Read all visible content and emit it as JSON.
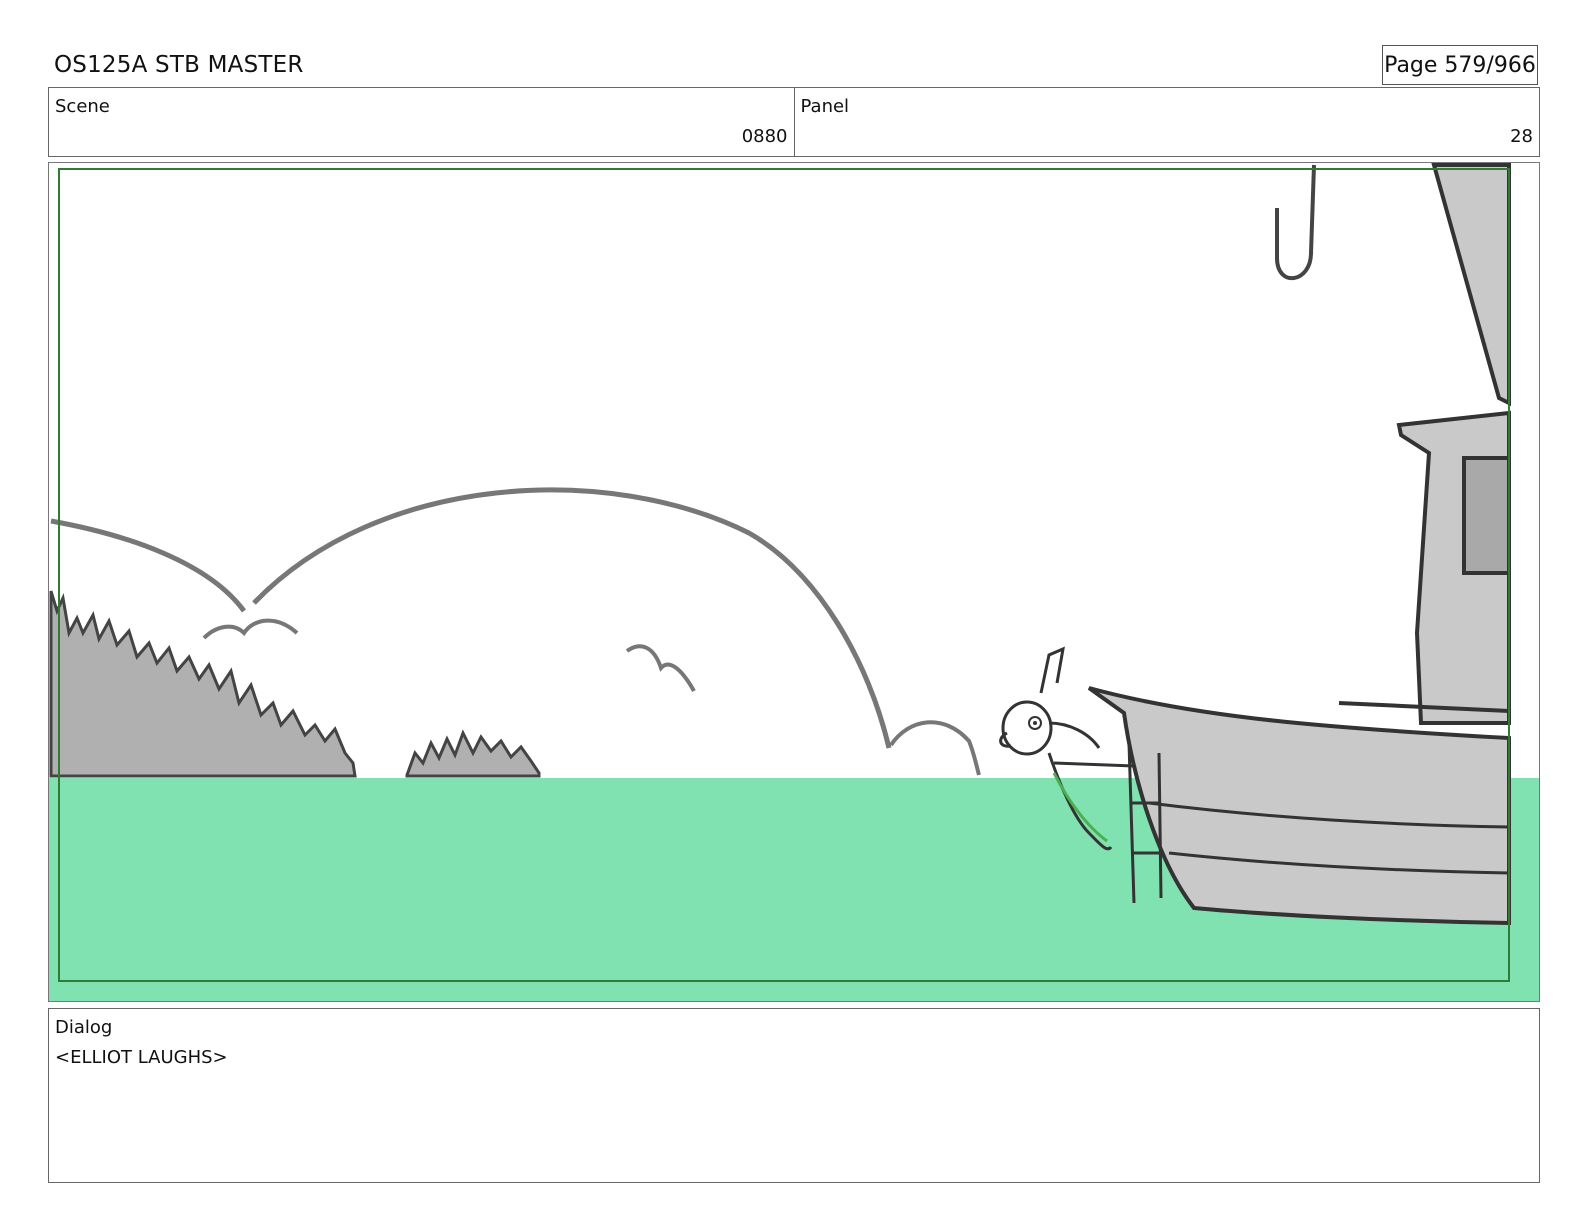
{
  "header": {
    "title": "OS125A STB MASTER",
    "page": "Page 579/966"
  },
  "scene": {
    "label": "Scene",
    "value": "0880"
  },
  "panel": {
    "label": "Panel",
    "value": "28"
  },
  "dialog": {
    "label": "Dialog",
    "text": "<ELLIOT LAUGHS>"
  },
  "colors": {
    "water": "#80e2b0",
    "safe_frame": "#2e7d32",
    "boat_fill": "#c9c9c9",
    "hill_fill": "#b0b0b0",
    "sketch_line": "#333333"
  }
}
